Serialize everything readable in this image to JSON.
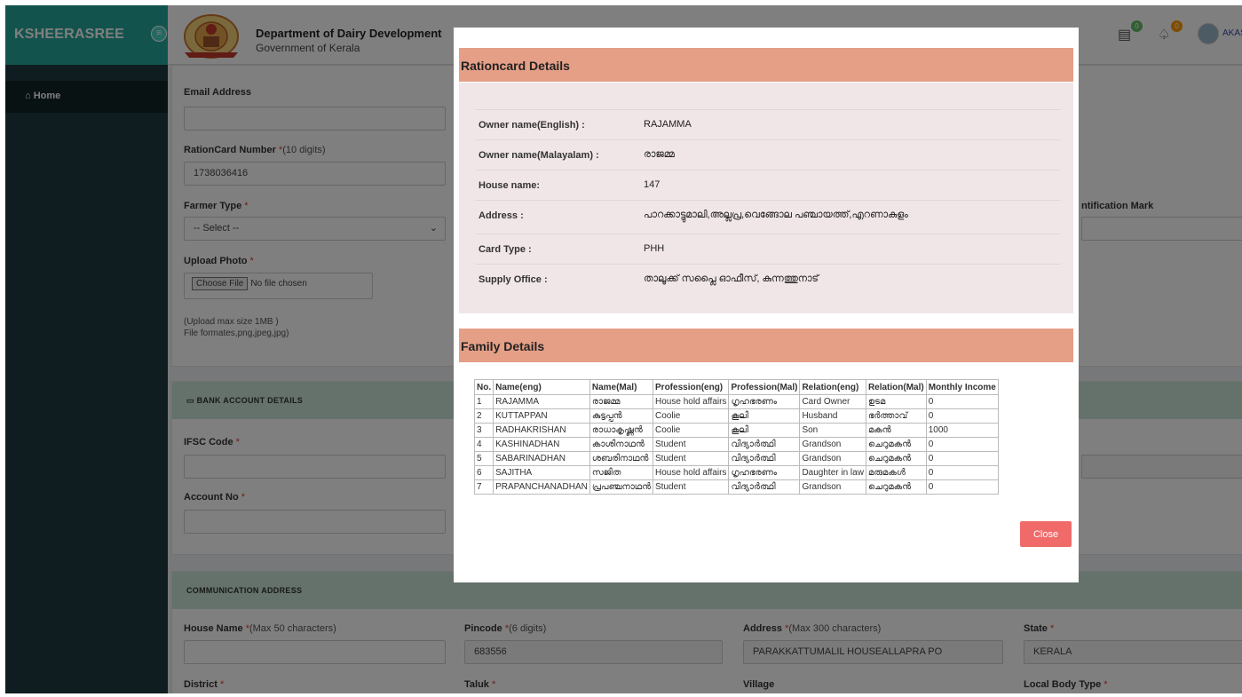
{
  "app": {
    "brand": "KSHEERASREE",
    "dept_title": "Department of Dairy Development",
    "dept_subtitle": "Government of Kerala",
    "user_name": "AKASH",
    "badges": {
      "messages": "0",
      "notifications": "0"
    }
  },
  "sidebar": {
    "items": [
      {
        "label": "Home"
      }
    ]
  },
  "form": {
    "email": {
      "label": "Email Address",
      "value": ""
    },
    "rationcard": {
      "label": "RationCard Number ",
      "req": "*",
      "hint": "(10 digits)",
      "value": "1738036416"
    },
    "farmer_type": {
      "label": "Farmer Type ",
      "req": "*",
      "value": "-- Select --"
    },
    "upload_photo": {
      "label": "Upload Photo ",
      "req": "*",
      "button": "Choose File",
      "status": "No file chosen",
      "hint1": "(Upload max size 1MB )",
      "hint2": "File formates,png,jpeg,jpg)"
    },
    "identification_mark": {
      "label": "ntification Mark"
    },
    "bank_section": "BANK ACCOUNT DETAILS",
    "ifsc": {
      "label": "IFSC Code ",
      "req": "*"
    },
    "account_no": {
      "label": "Account No ",
      "req": "*"
    },
    "comm_section": "COMMUNICATION ADDRESS",
    "house_name": {
      "label": "House Name ",
      "req": "*",
      "hint": "(Max 50 characters)",
      "value": ""
    },
    "pincode": {
      "label": "Pincode ",
      "req": "*",
      "hint": "(6 digits)",
      "value": "683556"
    },
    "address": {
      "label": "Address ",
      "req": "*",
      "hint": "(Max 300 characters)",
      "value": "PARAKKATTUMALIL HOUSEALLAPRA PO"
    },
    "state": {
      "label": "State ",
      "req": "*",
      "value": "KERALA"
    },
    "district": {
      "label": "District ",
      "req": "*"
    },
    "taluk": {
      "label": "Taluk ",
      "req": "*"
    },
    "village": {
      "label": "Village"
    },
    "local_body_type": {
      "label": "Local Body Type ",
      "req": "*"
    }
  },
  "modal": {
    "rationcard_title": "Rationcard Details",
    "details": [
      {
        "key": "Owner name(English) :",
        "value": "RAJAMMA"
      },
      {
        "key": "Owner name(Malayalam) :",
        "value": "രാജമ്മ"
      },
      {
        "key": "House name:",
        "value": "147"
      },
      {
        "key": "Address :",
        "value": "പാറക്കാട്ടുമാലി,അല്ലപ്ര,വെങ്ങോല പഞ്ചായത്ത്,എറണാകുളം"
      },
      {
        "key": "Card Type :",
        "value": "PHH"
      },
      {
        "key": "Supply Office :",
        "value": "താലൂക്ക് സപ്ലൈ ഓഫീസ്, കുന്നത്തുനാട്"
      }
    ],
    "family_title": "Family Details",
    "family_headers": [
      "No.",
      "Name(eng)",
      "Name(Mal)",
      "Profession(eng)",
      "Profession(Mal)",
      "Relation(eng)",
      "Relation(Mal)",
      "Monthly Income"
    ],
    "family_rows": [
      [
        "1",
        "RAJAMMA",
        "രാജമ്മ",
        "House hold affairs",
        "ഗൃഹഭരണം",
        "Card Owner",
        "ഉടമ",
        "0"
      ],
      [
        "2",
        "KUTTAPPAN",
        "കുട്ടപ്പൻ",
        "Coolie",
        "കൂലി",
        "Husband",
        "ഭർത്താവ്",
        "0"
      ],
      [
        "3",
        "RADHAKRISHAN",
        "രാധാകൃഷ്ണൻ",
        "Coolie",
        "കൂലി",
        "Son",
        "മകൻ",
        "1000"
      ],
      [
        "4",
        "KASHINADHAN",
        "കാശിനാഥൻ",
        "Student",
        "വിദ്യാർത്ഥി",
        "Grandson",
        "ചെറുമകൻ",
        "0"
      ],
      [
        "5",
        "SABARINADHAN",
        "ശബരിനാഥൻ",
        "Student",
        "വിദ്യാർത്ഥി",
        "Grandson",
        "ചെറുമകൻ",
        "0"
      ],
      [
        "6",
        "SAJITHA",
        "സജിത",
        "House hold affairs",
        "ഗൃഹഭരണം",
        "Daughter in law",
        "മരുമകൾ",
        "0"
      ],
      [
        "7",
        "PRAPANCHANADHAN",
        "പ്രപഞ്ചനാഥൻ",
        "Student",
        "വിദ്യാർത്ഥി",
        "Grandson",
        "ചെറുമകൻ",
        "0"
      ]
    ],
    "close_label": "Close"
  },
  "colors": {
    "brand": "#26a69a",
    "modal_header": "#e59f87",
    "modal_body": "#f0e5e7",
    "close_button": "#f06a6a",
    "section_header": "#cbe4d6",
    "sidebar": "#1e3a40"
  }
}
